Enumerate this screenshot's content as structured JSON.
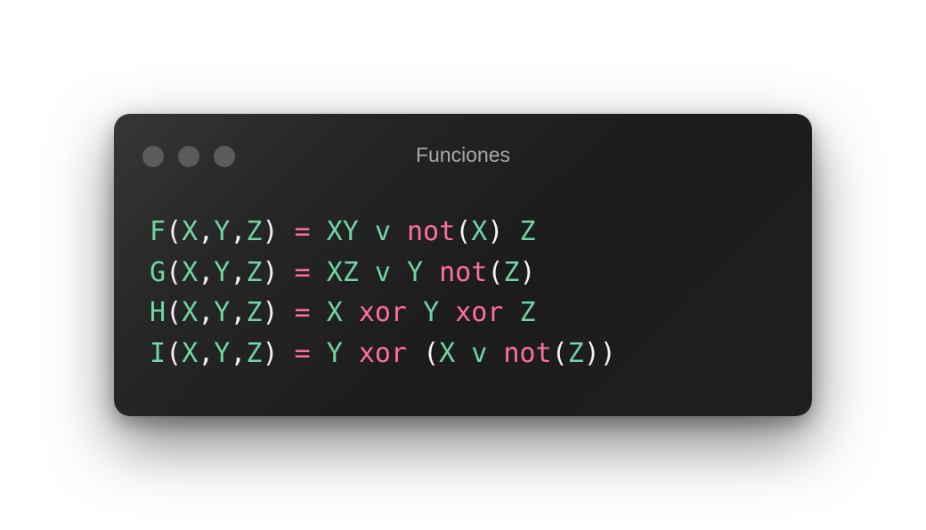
{
  "window": {
    "title": "Funciones",
    "controls": [
      "close-dot",
      "minimize-dot",
      "maximize-dot"
    ]
  },
  "colors": {
    "identifier": "#6fd5a3",
    "keyword": "#ff6f9c",
    "punctuation": "#f2f2f2",
    "title": "#a8a8a8",
    "window_dot": "#5b5b5b"
  },
  "code": {
    "lines": [
      {
        "text": "F(X,Y,Z) = XY v not(X) Z",
        "tokens": [
          {
            "t": "F",
            "k": "fn"
          },
          {
            "t": "(",
            "k": "punc"
          },
          {
            "t": "X",
            "k": "var"
          },
          {
            "t": ",",
            "k": "punc"
          },
          {
            "t": "Y",
            "k": "var"
          },
          {
            "t": ",",
            "k": "punc"
          },
          {
            "t": "Z",
            "k": "var"
          },
          {
            "t": ") ",
            "k": "punc"
          },
          {
            "t": "= ",
            "k": "op"
          },
          {
            "t": "XY v ",
            "k": "var"
          },
          {
            "t": "not",
            "k": "kw"
          },
          {
            "t": "(",
            "k": "punc"
          },
          {
            "t": "X",
            "k": "var"
          },
          {
            "t": ") ",
            "k": "punc"
          },
          {
            "t": "Z",
            "k": "var"
          }
        ]
      },
      {
        "text": "G(X,Y,Z) = XZ v Y not(Z)",
        "tokens": [
          {
            "t": "G",
            "k": "fn"
          },
          {
            "t": "(",
            "k": "punc"
          },
          {
            "t": "X",
            "k": "var"
          },
          {
            "t": ",",
            "k": "punc"
          },
          {
            "t": "Y",
            "k": "var"
          },
          {
            "t": ",",
            "k": "punc"
          },
          {
            "t": "Z",
            "k": "var"
          },
          {
            "t": ") ",
            "k": "punc"
          },
          {
            "t": "= ",
            "k": "op"
          },
          {
            "t": "XZ v Y ",
            "k": "var"
          },
          {
            "t": "not",
            "k": "kw"
          },
          {
            "t": "(",
            "k": "punc"
          },
          {
            "t": "Z",
            "k": "var"
          },
          {
            "t": ")",
            "k": "punc"
          }
        ]
      },
      {
        "text": "H(X,Y,Z) = X xor Y xor Z",
        "tokens": [
          {
            "t": "H",
            "k": "fn"
          },
          {
            "t": "(",
            "k": "punc"
          },
          {
            "t": "X",
            "k": "var"
          },
          {
            "t": ",",
            "k": "punc"
          },
          {
            "t": "Y",
            "k": "var"
          },
          {
            "t": ",",
            "k": "punc"
          },
          {
            "t": "Z",
            "k": "var"
          },
          {
            "t": ") ",
            "k": "punc"
          },
          {
            "t": "= ",
            "k": "op"
          },
          {
            "t": "X ",
            "k": "var"
          },
          {
            "t": "xor ",
            "k": "kw"
          },
          {
            "t": "Y ",
            "k": "var"
          },
          {
            "t": "xor ",
            "k": "kw"
          },
          {
            "t": "Z",
            "k": "var"
          }
        ]
      },
      {
        "text": "I(X,Y,Z) = Y xor (X v not(Z))",
        "tokens": [
          {
            "t": "I",
            "k": "fn"
          },
          {
            "t": "(",
            "k": "punc"
          },
          {
            "t": "X",
            "k": "var"
          },
          {
            "t": ",",
            "k": "punc"
          },
          {
            "t": "Y",
            "k": "var"
          },
          {
            "t": ",",
            "k": "punc"
          },
          {
            "t": "Z",
            "k": "var"
          },
          {
            "t": ") ",
            "k": "punc"
          },
          {
            "t": "= ",
            "k": "op"
          },
          {
            "t": "Y ",
            "k": "var"
          },
          {
            "t": "xor ",
            "k": "kw"
          },
          {
            "t": "(",
            "k": "punc"
          },
          {
            "t": "X v ",
            "k": "var"
          },
          {
            "t": "not",
            "k": "kw"
          },
          {
            "t": "(",
            "k": "punc"
          },
          {
            "t": "Z",
            "k": "var"
          },
          {
            "t": "))",
            "k": "punc"
          }
        ]
      }
    ]
  }
}
